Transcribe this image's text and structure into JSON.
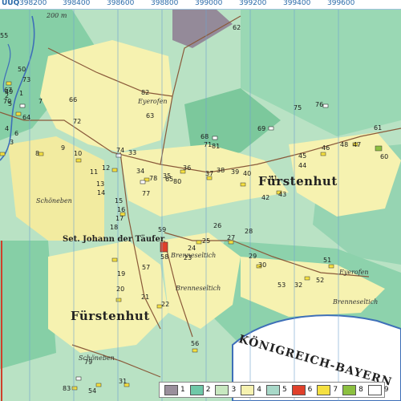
{
  "grid": {
    "corner_label": "UUQ",
    "x_coords": [
      "398200",
      "398400",
      "398600",
      "398800",
      "399000",
      "399200",
      "399400",
      "399600"
    ]
  },
  "scale_label": "200 m",
  "places": {
    "fuerstenhut_main": "Fürstenhut",
    "fuerstenhut_east": "Fürstenhut",
    "st_johann": "Set. Johann der Täufer",
    "eyerofen_north": "Eyerofen",
    "eyerofen_east": "Eyerofen",
    "schoeneben_west": "Schöneben",
    "schoeneben_south": "Schöneben",
    "brennesettich_1": "Brenneseltich",
    "brennesettich_2": "Brenneseltich",
    "brennesettich_3": "Brenneseltich",
    "country": "KÖNIGREICH-BAYERN"
  },
  "parcel_numbers": [
    "1",
    "2",
    "3",
    "4",
    "5",
    "6",
    "7",
    "8",
    "9",
    "10",
    "11",
    "12",
    "13",
    "14",
    "15",
    "16",
    "17",
    "18",
    "19",
    "20",
    "21",
    "22",
    "23",
    "24",
    "25",
    "26",
    "27",
    "28",
    "29",
    "30",
    "31",
    "32",
    "33",
    "34",
    "35",
    "36",
    "37",
    "38",
    "39",
    "40",
    "41",
    "42",
    "43",
    "44",
    "45",
    "46",
    "47",
    "48",
    "49",
    "50",
    "51",
    "52",
    "53",
    "54",
    "55",
    "56",
    "57",
    "58",
    "59",
    "60",
    "61",
    "62",
    "63",
    "64",
    "65",
    "66",
    "67",
    "68",
    "69",
    "70",
    "71",
    "72",
    "73",
    "74",
    "75",
    "76",
    "77",
    "78",
    "79",
    "80",
    "81",
    "82",
    "83"
  ],
  "legend": {
    "items": [
      {
        "label": "1",
        "color": "#9a8f9c"
      },
      {
        "label": "2",
        "color": "#6fc8a8"
      },
      {
        "label": "3",
        "color": "#c8e8c0"
      },
      {
        "label": "4",
        "color": "#f6f2b0"
      },
      {
        "label": "5",
        "color": "#a8d8c8"
      },
      {
        "label": "6",
        "color": "#e0402a"
      },
      {
        "label": "7",
        "color": "#f5e040"
      },
      {
        "label": "8",
        "color": "#8cc040"
      },
      {
        "label": "9",
        "color": "#ffffff"
      }
    ]
  }
}
